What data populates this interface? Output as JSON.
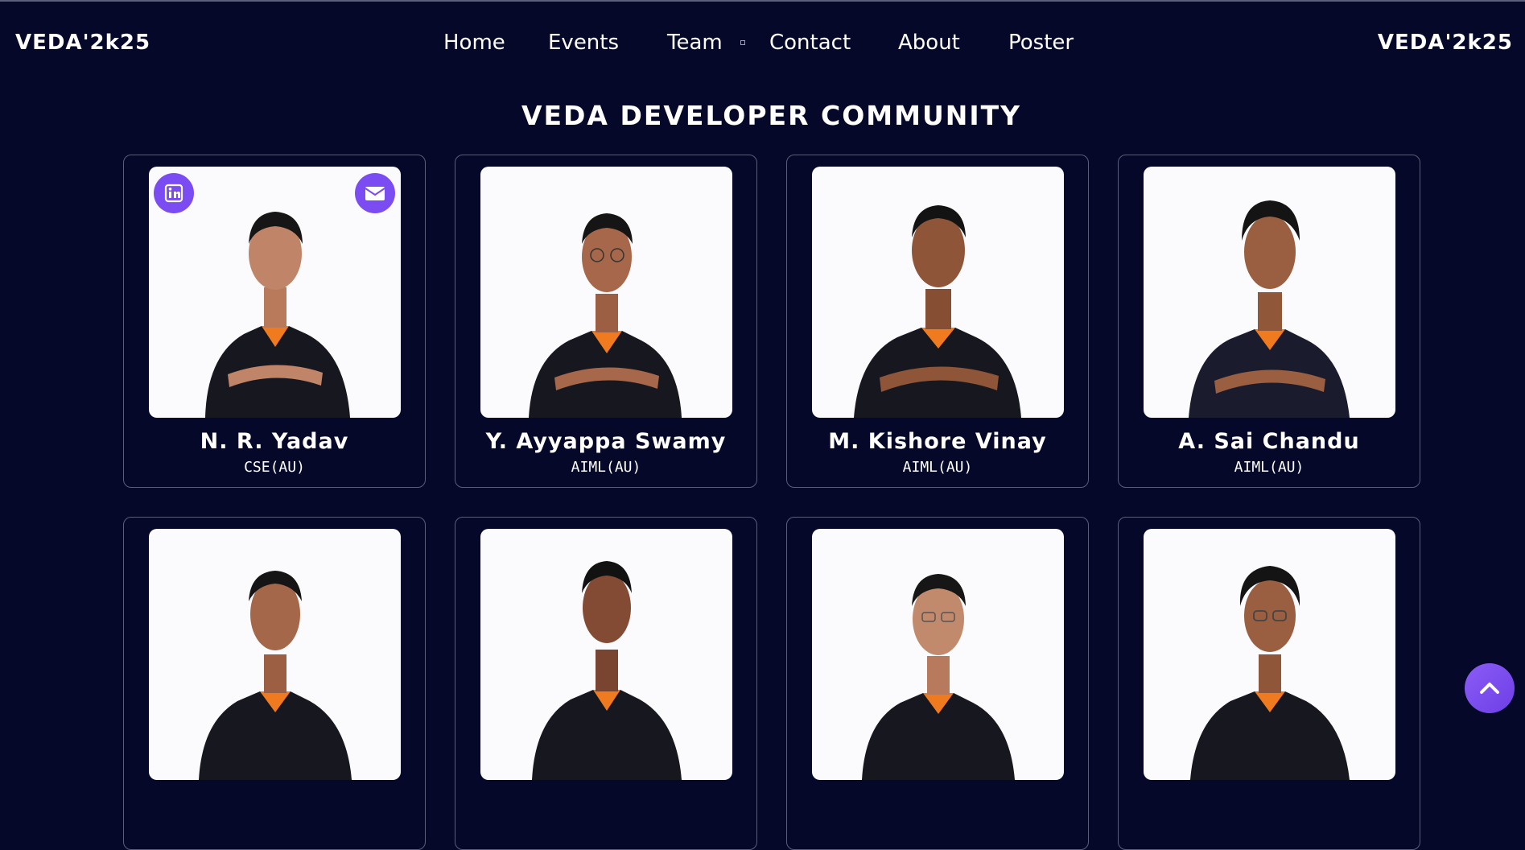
{
  "nav": {
    "brand_left": "VEDA'2k25",
    "brand_right": "VEDA'2k25",
    "items": [
      {
        "label": "Home"
      },
      {
        "label": "Events"
      },
      {
        "label": "Team"
      },
      {
        "label": "Contact"
      },
      {
        "label": "About"
      },
      {
        "label": "Poster"
      }
    ]
  },
  "section": {
    "title": "VEDA DEVELOPER COMMUNITY"
  },
  "members": [
    {
      "name": "N. R. Yadav",
      "dept": "CSE(AU)"
    },
    {
      "name": "Y. Ayyappa Swamy",
      "dept": "AIML(AU)"
    },
    {
      "name": "M. Kishore Vinay",
      "dept": "AIML(AU)"
    },
    {
      "name": "A. Sai Chandu",
      "dept": "AIML(AU)"
    },
    {
      "name": "",
      "dept": ""
    },
    {
      "name": "",
      "dept": ""
    },
    {
      "name": "",
      "dept": ""
    },
    {
      "name": "",
      "dept": ""
    }
  ],
  "icons": {
    "linkedin": "linkedin-icon",
    "mail": "envelope-icon",
    "scroll_top": "chevron-up-icon"
  },
  "colors": {
    "background": "#050828",
    "accent": "#7b4cf1",
    "card_border": "#5a5e7a",
    "shirt": "#17181f",
    "collar": "#f07a1e"
  }
}
